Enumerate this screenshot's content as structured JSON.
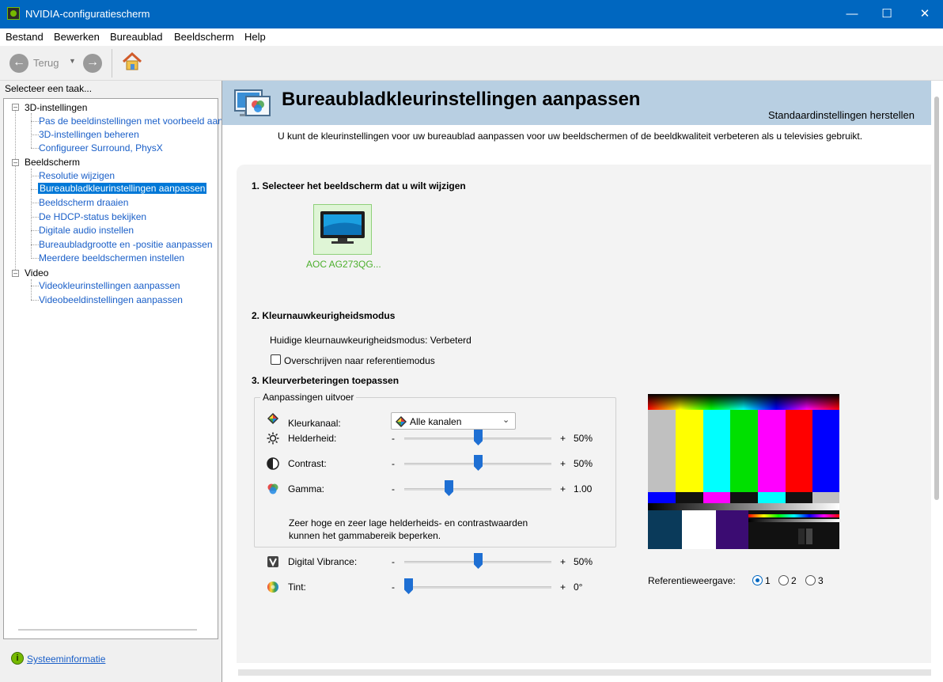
{
  "window": {
    "title": "NVIDIA-configuratiescherm"
  },
  "menu": [
    "Bestand",
    "Bewerken",
    "Bureaublad",
    "Beeldscherm",
    "Help"
  ],
  "toolbar": {
    "back_label": "Terug"
  },
  "left_panel": {
    "heading": "Selecteer een taak...",
    "categories": [
      {
        "label": "3D-instellingen",
        "items": [
          "Pas de beeldinstellingen met voorbeeld aan",
          "3D-instellingen beheren",
          "Configureer Surround, PhysX"
        ]
      },
      {
        "label": "Beeldscherm",
        "items": [
          "Resolutie wijzigen",
          "Bureaubladkleurinstellingen aanpassen",
          "Beeldscherm draaien",
          "De HDCP-status bekijken",
          "Digitale audio instellen",
          "Bureaubladgrootte en -positie aanpassen",
          "Meerdere beeldschermen instellen"
        ]
      },
      {
        "label": "Video",
        "items": [
          "Videokleurinstellingen aanpassen",
          "Videobeeldinstellingen aanpassen"
        ]
      }
    ],
    "selected_item": "Bureaubladkleurinstellingen aanpassen",
    "system_info_label": "Systeeminformatie"
  },
  "page": {
    "title": "Bureaubladkleurinstellingen aanpassen",
    "restore_label": "Standaardinstellingen herstellen",
    "intro": "U kunt de kleurinstellingen voor uw bureaublad aanpassen voor uw beeldschermen of de beeldkwaliteit verbeteren als u televisies gebruikt."
  },
  "section1": {
    "heading": "1. Selecteer het beeldscherm dat u wilt wijzigen",
    "monitor_label": "AOC AG273QG..."
  },
  "section2": {
    "heading": "2. Kleurnauwkeurigheidsmodus",
    "current_mode": "Huidige kleurnauwkeurigheidsmodus: Verbeterd",
    "override_label": "Overschrijven naar referentiemodus",
    "override_checked": false
  },
  "section3": {
    "heading": "3. Kleurverbeteringen toepassen",
    "group_title": "Aanpassingen uitvoer",
    "channel_label": "Kleurkanaal:",
    "channel_value": "Alle kanalen",
    "sliders": [
      {
        "label": "Helderheid:",
        "minus": "-",
        "plus": "+",
        "value": "50%",
        "fraction": 0.5,
        "icon": "sun-icon"
      },
      {
        "label": "Contrast:",
        "minus": "-",
        "plus": "+",
        "value": "50%",
        "fraction": 0.5,
        "icon": "contrast-icon"
      },
      {
        "label": "Gamma:",
        "minus": "-",
        "plus": "+",
        "value": "1.00",
        "fraction": 0.29,
        "icon": "gamma-icon"
      }
    ],
    "warning": [
      "Zeer hoge en zeer lage helderheids- en contrastwaarden",
      "kunnen het gammabereik beperken."
    ],
    "extra_sliders": [
      {
        "label": "Digital Vibrance:",
        "minus": "-",
        "plus": "+",
        "value": "50%",
        "fraction": 0.5,
        "icon": "vibrance-icon"
      },
      {
        "label": "Tint:",
        "minus": "-",
        "plus": "+",
        "value": "0°",
        "fraction": 0.0,
        "icon": "tint-icon"
      }
    ]
  },
  "reference": {
    "label": "Referentieweergave:",
    "options": [
      "1",
      "2",
      "3"
    ],
    "selected": "1"
  },
  "colors": {
    "titlebar": "#0067c0",
    "accent": "#1e6fd3",
    "link": "#1a5fc8",
    "nvidia_green": "#76b900",
    "banner": "#b8cfe2"
  }
}
